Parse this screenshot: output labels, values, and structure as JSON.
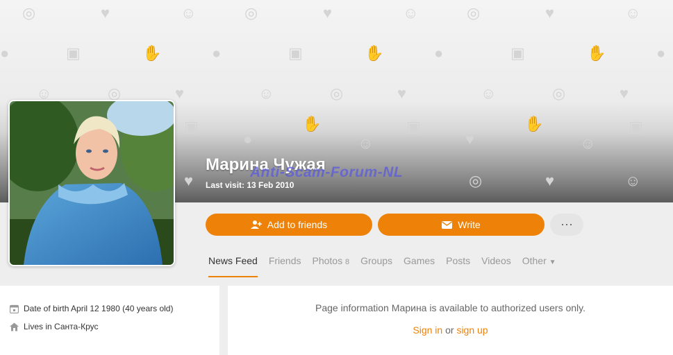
{
  "profile": {
    "name": "Марина Чужая",
    "last_visit": "Last visit: 13 Feb 2010",
    "watermark": "Anti-Scam-Forum-NL"
  },
  "actions": {
    "add_friends": "Add to friends",
    "write": "Write",
    "more": "⋯"
  },
  "nav": {
    "news_feed": "News Feed",
    "friends": "Friends",
    "photos": "Photos",
    "photos_count": "8",
    "groups": "Groups",
    "games": "Games",
    "posts": "Posts",
    "videos": "Videos",
    "other": "Other"
  },
  "info": {
    "dob": "Date of birth April 12 1980 (40 years old)",
    "lives": "Lives in Санта-Крус"
  },
  "main": {
    "message": "Page information Марина is available to authorized users only.",
    "sign_in": "Sign in",
    "or": " or ",
    "sign_up": "sign up"
  },
  "colors": {
    "accent": "#ee8208"
  },
  "icons": [
    "compass-icon",
    "heart-icon",
    "smiley-icon",
    "image-icon",
    "thumbs-up-icon",
    "speech-bubble-icon",
    "add-friend-icon",
    "envelope-icon",
    "chevron-down-icon",
    "calendar-icon",
    "home-icon"
  ]
}
